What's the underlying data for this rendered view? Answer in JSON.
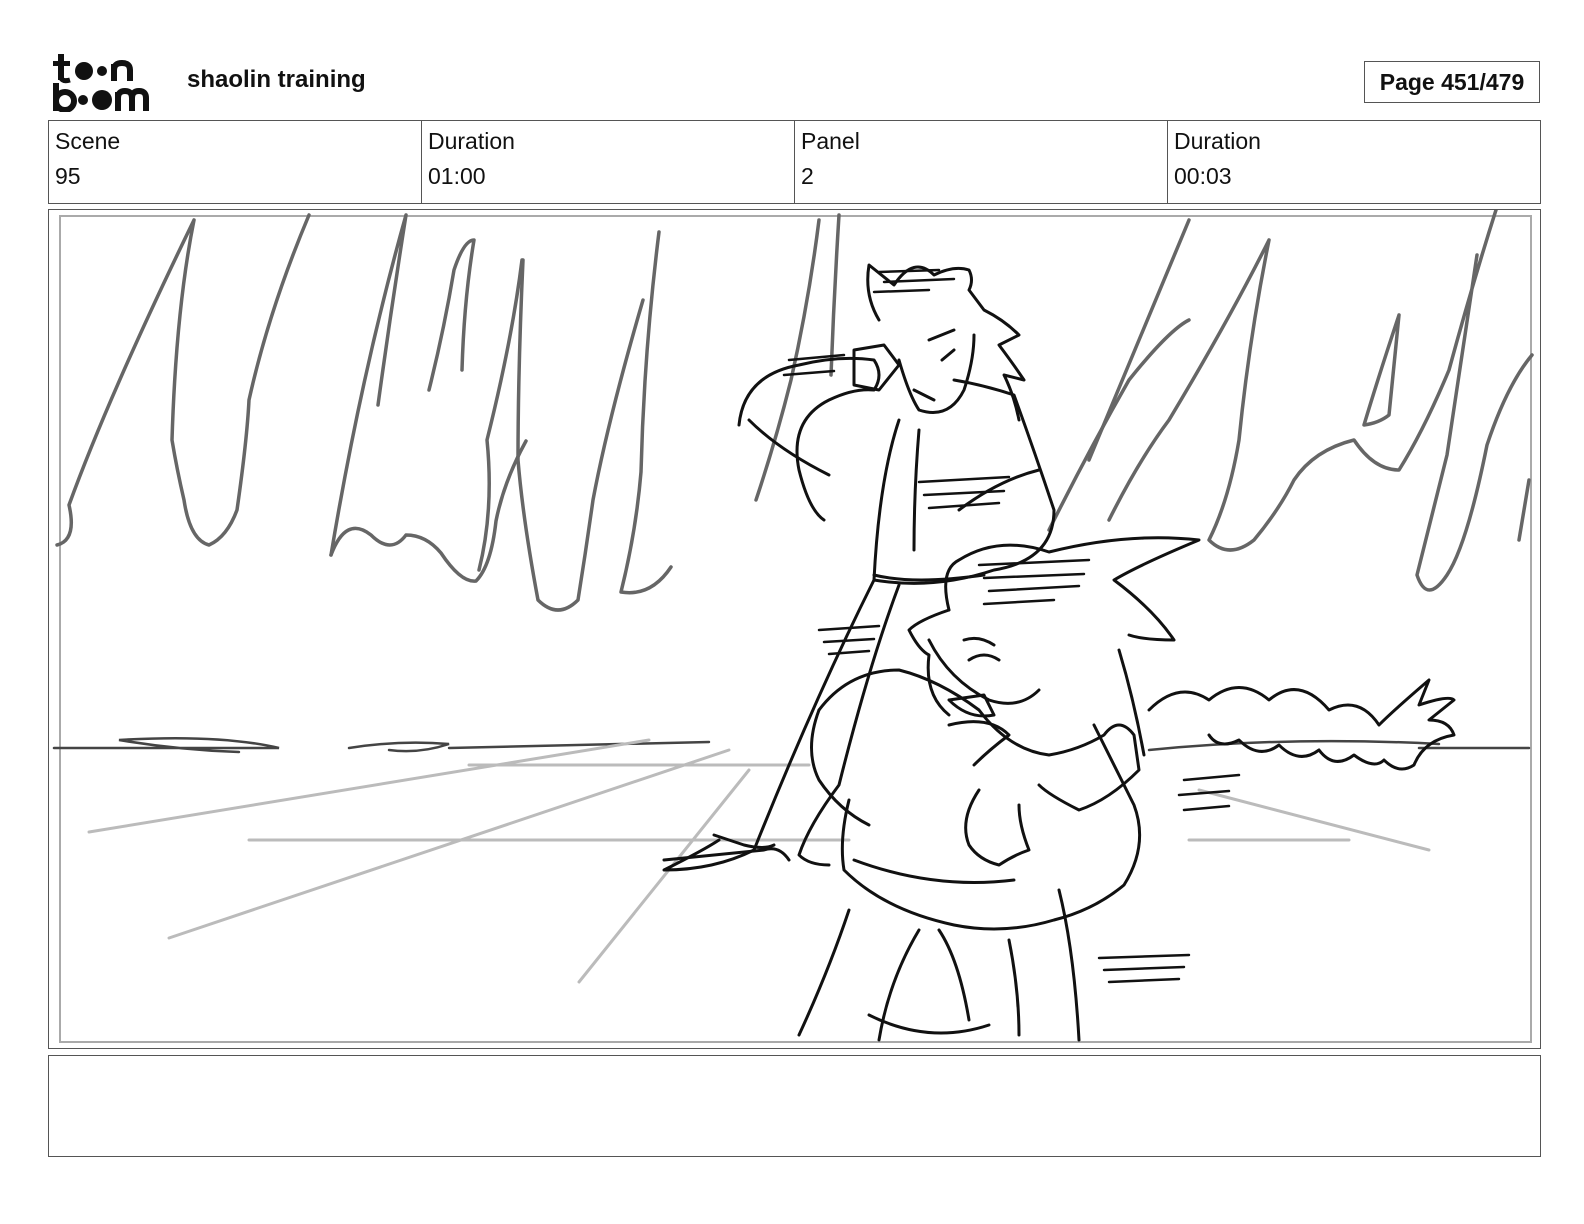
{
  "header": {
    "logo_text": "toonboom",
    "logo_icon": "toonboom-logo-icon",
    "project_title": "shaolin training",
    "page_label": "Page 451/479"
  },
  "info": {
    "scene_label": "Scene",
    "scene_value": "95",
    "scene_duration_label": "Duration",
    "scene_duration_value": "01:00",
    "panel_label": "Panel",
    "panel_value": "2",
    "panel_duration_label": "Duration",
    "panel_duration_value": "00:03"
  },
  "panel": {
    "image_icon": "storyboard-sketch-fighters"
  },
  "notes": {
    "text": ""
  },
  "colors": {
    "border": "#555555",
    "sketch_dark": "#111111",
    "sketch_mid": "#666666",
    "sketch_light": "#bbbbbb"
  }
}
